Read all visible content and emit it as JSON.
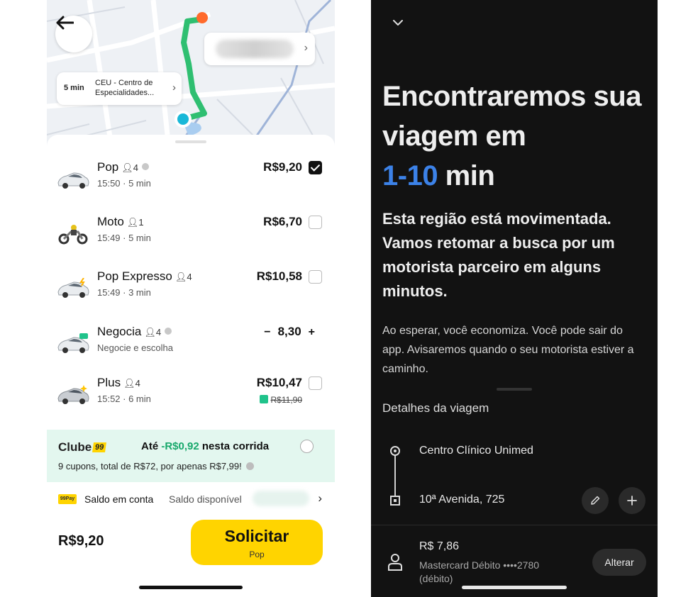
{
  "left": {
    "map": {
      "origin_eta": "5 min",
      "origin_name": "CEU - Centro de Especialidades...",
      "origin_chevron": "›",
      "dest_chevron": "›",
      "route_color": "#2fbf71",
      "dest_marker_color": "#ff6a2b",
      "origin_marker_color": "#19b8d8"
    },
    "rides": [
      {
        "name": "Pop",
        "seats": "4",
        "sub": "15:50 · 5 min",
        "price": "R$9,20",
        "selected": true
      },
      {
        "name": "Moto",
        "seats": "1",
        "sub": "15:49 · 5 min",
        "price": "R$6,70",
        "selected": false
      },
      {
        "name": "Pop Expresso",
        "seats": "4",
        "sub": "15:49 · 3 min",
        "price": "R$10,58",
        "selected": false
      },
      {
        "name": "Negocia",
        "seats": "4",
        "sub": "Negocie e escolha",
        "minus": "−",
        "value": "8,30",
        "plus": "+"
      },
      {
        "name": "Plus",
        "seats": "4",
        "sub": "15:52 · 6 min",
        "price": "R$10,47",
        "old_price": "R$11,90",
        "selected": false
      }
    ],
    "clube": {
      "logo": "Clube",
      "badge": "99",
      "ate_prefix": "Até ",
      "discount": "-R$0,92",
      "ate_suffix": " nesta corrida",
      "sub": "9 cupons, total de R$72, por apenas R$7,99!"
    },
    "saldo": {
      "logo": "99Pay",
      "label": "Saldo em conta",
      "available": "Saldo disponível",
      "chevron": "›"
    },
    "total": "R$9,20",
    "cta_label": "Solicitar",
    "cta_sub": "Pop",
    "accent": "#ffd400"
  },
  "right": {
    "headline_1": "Encontraremos sua viagem em",
    "headline_time": "1-10",
    "headline_unit": " min",
    "bold_text": "Esta região está movimentada. Vamos retomar a busca por um motorista parceiro em alguns minutos.",
    "soft_text": "Ao esperar, você economiza. Você pode sair do app. Avisaremos quando o seu motorista estiver a caminho.",
    "section_title": "Detalhes da viagem",
    "stop_a": "Centro Clínico Unimed",
    "stop_b": "10ª Avenida, 725",
    "fare": "R$ 7,86",
    "card_line1": "Mastercard Débito ••••2780",
    "card_line2": "(débito)",
    "change_label": "Alterar",
    "accent": "#3c82e8"
  }
}
